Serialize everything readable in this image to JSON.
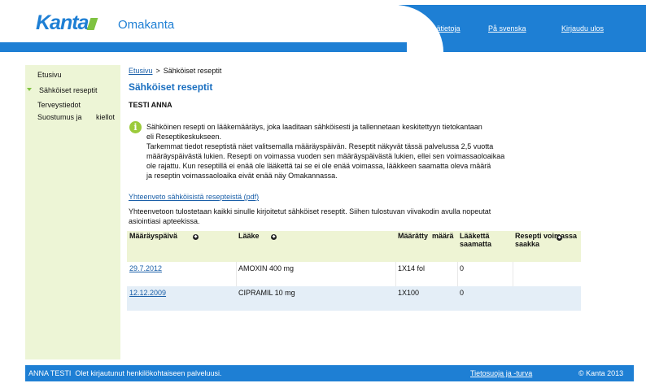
{
  "header": {
    "logo_text": "Kanta",
    "app_name": "Omakanta",
    "links": [
      "Lisätietoja",
      "På svenska",
      "Kirjaudu ulos"
    ],
    "brand_color": "#1e7fd4",
    "accent_color": "#7fc241"
  },
  "sidebar": {
    "items": [
      {
        "label": "Etusivu",
        "active": false
      },
      {
        "label": "Sähköiset reseptit",
        "active": true
      },
      {
        "label": "Terveystiedot",
        "active": false
      },
      {
        "label": "Suostumus ja       kiellot",
        "active": false
      }
    ]
  },
  "breadcrumb": {
    "home": "Etusivu",
    "separator": ">",
    "current": "Sähköiset reseptit"
  },
  "page_title": "Sähköiset reseptit",
  "patient_name": "TESTI ANNA",
  "info": {
    "icon": "info-icon",
    "lines": [
      "Sähköinen resepti on lääkemääräys, joka laaditaan sähköisesti ja tallennetaan keskitettyyn tietokantaan",
      "eli Reseptikeskukseen.",
      "Tarkemmat tiedot reseptistä näet valitsemalla määräyspäivän. Reseptit näkyvät tässä palvelussa 2,5 vuotta",
      "määräyspäivästä lukien. Resepti on voimassa vuoden sen määräyspäivästä lukien, ellei sen voimassaoloaikaa",
      "ole rajattu. Kun reseptillä ei enää ole lääkettä tai se ei ole enää voimassa, lääkkeen saamatta oleva määrä",
      "ja reseptin voimassaoloaika eivät enää näy Omakannassa."
    ]
  },
  "pdf_link": "Yhteenveto sähköisistä resepteistä (pdf)",
  "summary_lines": [
    "Yhteenvetoon tulostetaan kaikki sinulle kirjoitetut sähköiset reseptit. Siihen tulostuvan viivakodin avulla nopeutat",
    "asiointiasi apteekissa."
  ],
  "table": {
    "headers": [
      "Määräyspäivä",
      "Lääke",
      "Määrätty  määrä",
      "Lääkettä saamatta",
      "Resepti voimassa saakka"
    ],
    "rows": [
      {
        "date": "29.7.2012",
        "drug": "AMOXIN 400 mg",
        "amount": "1X14 fol",
        "remaining": "0",
        "valid_until": ""
      },
      {
        "date": "12.12.2009",
        "drug": "CIPRAMIL 10 mg",
        "amount": "1X100",
        "remaining": "0",
        "valid_until": ""
      }
    ]
  },
  "footer": {
    "user_text": "ANNA TESTI  Olet kirjautunut henkilökohtaiseen palveluusi.",
    "privacy_link": "Tietosuoja ja -turva",
    "copyright": "© Kanta 2013"
  }
}
